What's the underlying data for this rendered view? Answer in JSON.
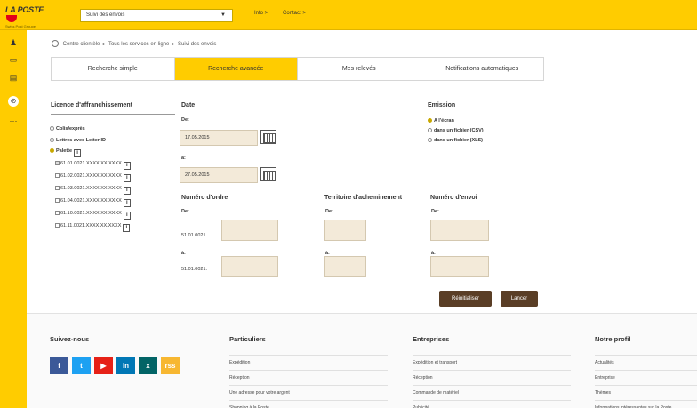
{
  "brand": {
    "logo_text": "LA POSTE",
    "logo_sub": "Swiss Post Groupe"
  },
  "topbar": {
    "service_select": "Suivi des envois",
    "links": [
      "Info >",
      "Contact >"
    ]
  },
  "rail_icons": [
    "user-icon",
    "package-icon",
    "document-icon",
    "compass-icon",
    "more-icon"
  ],
  "breadcrumb": [
    "Centre clientèle",
    "Tous les services en ligne",
    "Suivi des envois"
  ],
  "tabs": [
    "Recherche simple",
    "Recherche avancée",
    "Mes relevés",
    "Notifications automatiques"
  ],
  "active_tab": 1,
  "license": {
    "heading": "Licence d'affranchissement",
    "options": [
      "Colis/exprès",
      "Lettres avec Letter ID",
      "Palette"
    ],
    "selected": 2,
    "numbers": [
      "61.01.0021.XXXX.XX.XXXX",
      "61.02.0021.XXXX.XX.XXXX",
      "61.03.0021.XXXX.XX.XXXX",
      "61.04.0021.XXXX.XX.XXXX",
      "61.10.0021.XXXX.XX.XXXX",
      "61.11.0021.XXXX.XX.XXXX"
    ],
    "checked": [
      0
    ]
  },
  "date": {
    "heading": "Date",
    "from_label": "De:",
    "from_value": "17.05.2015",
    "to_label": "à:",
    "to_value": "27.05.2015"
  },
  "emission": {
    "heading": "Emission",
    "options": [
      "A l'écran",
      "dans un fichier (CSV)",
      "dans un fichier (XLS)"
    ],
    "selected": 0
  },
  "order_number": {
    "heading": "Numéro d'ordre",
    "from_label": "De:",
    "from_prefix": "51.01.0021.",
    "to_label": "à:",
    "to_prefix": "51.01.0021."
  },
  "territory": {
    "heading": "Territoire d'acheminement",
    "from_label": "De:",
    "to_label": "à:"
  },
  "shipment_number": {
    "heading": "Numéro d'envoi",
    "from_label": "De:",
    "to_label": "à:"
  },
  "buttons": {
    "reset": "Réinitialiser",
    "submit": "Lancer"
  },
  "footer": {
    "social": {
      "heading": "Suivez-nous",
      "icons": [
        "f",
        "t",
        "▶",
        "in",
        "x",
        "rss"
      ],
      "colors": [
        "#3b5998",
        "#1da1f2",
        "#e62117",
        "#0077b5",
        "#026466",
        "#f7b731"
      ]
    },
    "particuliers": {
      "heading": "Particuliers",
      "links": [
        "Expédition",
        "Réception",
        "Une adresse pour votre argent",
        "Shopping à la Poste"
      ]
    },
    "entreprises": {
      "heading": "Entreprises",
      "links": [
        "Expédition et transport",
        "Réception",
        "Commande de matériel",
        "Publicité"
      ]
    },
    "profil": {
      "heading": "Notre profil",
      "links": [
        "Actualités",
        "Entreprise",
        "Thèmes",
        "Informations intéressantes sur la Poste"
      ]
    }
  }
}
